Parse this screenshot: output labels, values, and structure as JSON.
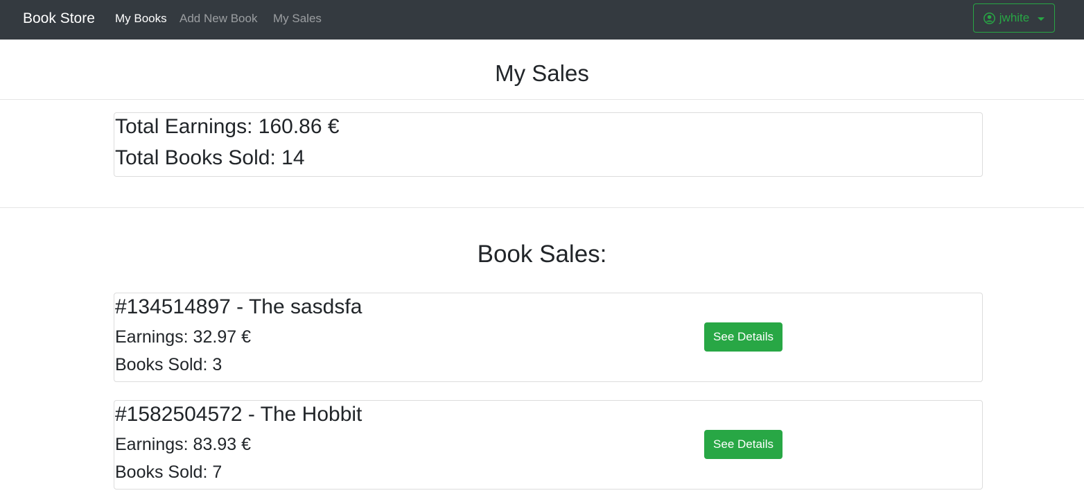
{
  "navbar": {
    "brand": "Book Store",
    "links": [
      {
        "label": "My Books",
        "active": true
      },
      {
        "label": "Add New Book",
        "active": false
      },
      {
        "label": "My Sales",
        "active": false
      }
    ],
    "user": {
      "name": "jwhite",
      "icon": "user-circle-icon"
    }
  },
  "page": {
    "title": "My Sales"
  },
  "summary": {
    "total_earnings": "Total Earnings: 160.86 €",
    "total_books_sold": "Total Books Sold: 14"
  },
  "book_sales": {
    "title": "Book Sales:",
    "items": [
      {
        "title": "#134514897 - The sasdsfa",
        "earnings": "Earnings: 32.97 €",
        "books_sold": "Books Sold: 3",
        "button_label": "See Details"
      },
      {
        "title": "#1582504572 - The Hobbit",
        "earnings": "Earnings: 83.93 €",
        "books_sold": "Books Sold: 7",
        "button_label": "See Details"
      }
    ]
  },
  "colors": {
    "navbar_bg": "#343a40",
    "success": "#28a745",
    "text": "#212529"
  }
}
